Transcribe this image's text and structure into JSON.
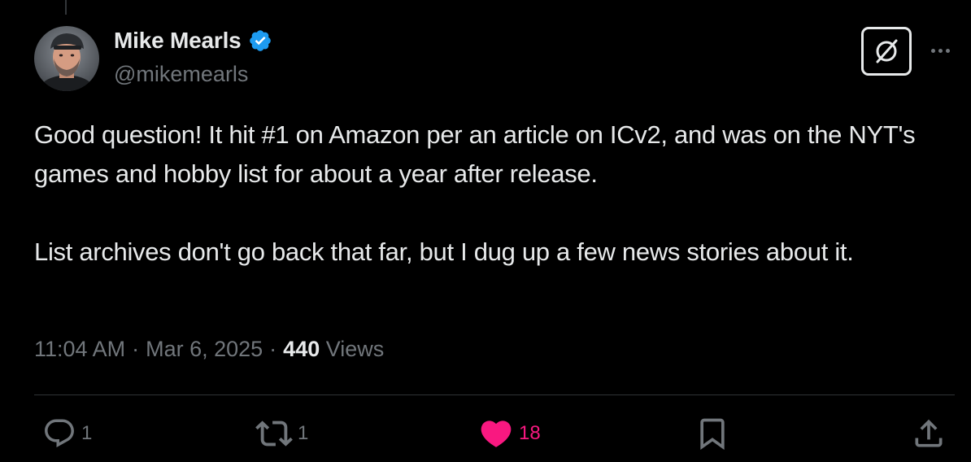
{
  "author": {
    "name": "Mike Mearls",
    "handle": "@mikemearls",
    "verified": true
  },
  "tweet": {
    "paragraphs": [
      "Good question! It hit #1 on Amazon per an article on ICv2, and was on the NYT's games and hobby list for about a year after release.",
      "List archives don't go back that far, but I dug up a few news stories about it."
    ],
    "time": "11:04 AM",
    "separator": "·",
    "date": "Mar 6, 2025",
    "views_count": "440",
    "views_label": "Views"
  },
  "actions": {
    "replies": "1",
    "reposts": "1",
    "likes": "18"
  },
  "icons": {
    "top_right": [
      "grok-icon",
      "more-icon"
    ],
    "action_bar": [
      "reply-icon",
      "repost-icon",
      "heart-icon",
      "bookmark-icon",
      "share-icon"
    ]
  },
  "colors": {
    "background": "#000000",
    "text_primary": "#e7e9ea",
    "text_secondary": "#71767b",
    "verified_blue": "#1d9bf0",
    "like_pink": "#f91880",
    "divider": "#2f3336"
  }
}
